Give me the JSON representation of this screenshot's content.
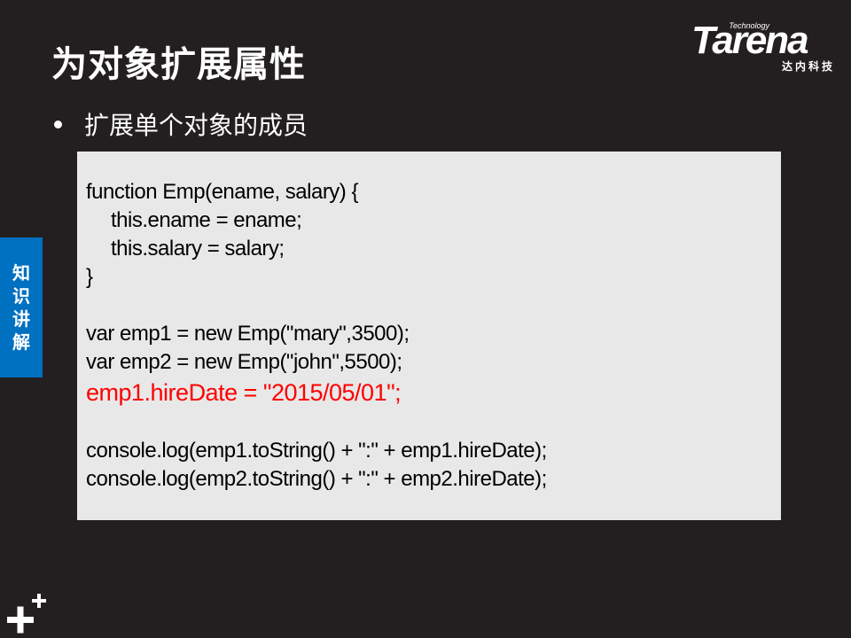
{
  "slide": {
    "title": "为对象扩展属性",
    "bullet": "扩展单个对象的成员",
    "side_tab": [
      "知",
      "识",
      "讲",
      "解"
    ]
  },
  "logo": {
    "tagline": "Technology",
    "wordmark": "Tarena",
    "subtitle": "达内科技"
  },
  "code": {
    "lines": [
      "function Emp(ename, salary) {",
      "this.ename = ename;",
      "this.salary = salary;",
      "}",
      "",
      "var emp1 = new Emp(\"mary\",3500);",
      "var emp2 = new Emp(\"john\",5500);",
      "emp1.hireDate = \"2015/05/01\";",
      "",
      "console.log(emp1.toString() + \":\" + emp1.hireDate);",
      "console.log(emp2.toString() + \":\" + emp2.hireDate);"
    ],
    "highlight_color": "#ff0000"
  },
  "colors": {
    "background": "#231f20",
    "code_background": "#e8e8e8",
    "side_tab": "#0070c0"
  },
  "icons": {
    "corner": "plus-plus-icon"
  }
}
